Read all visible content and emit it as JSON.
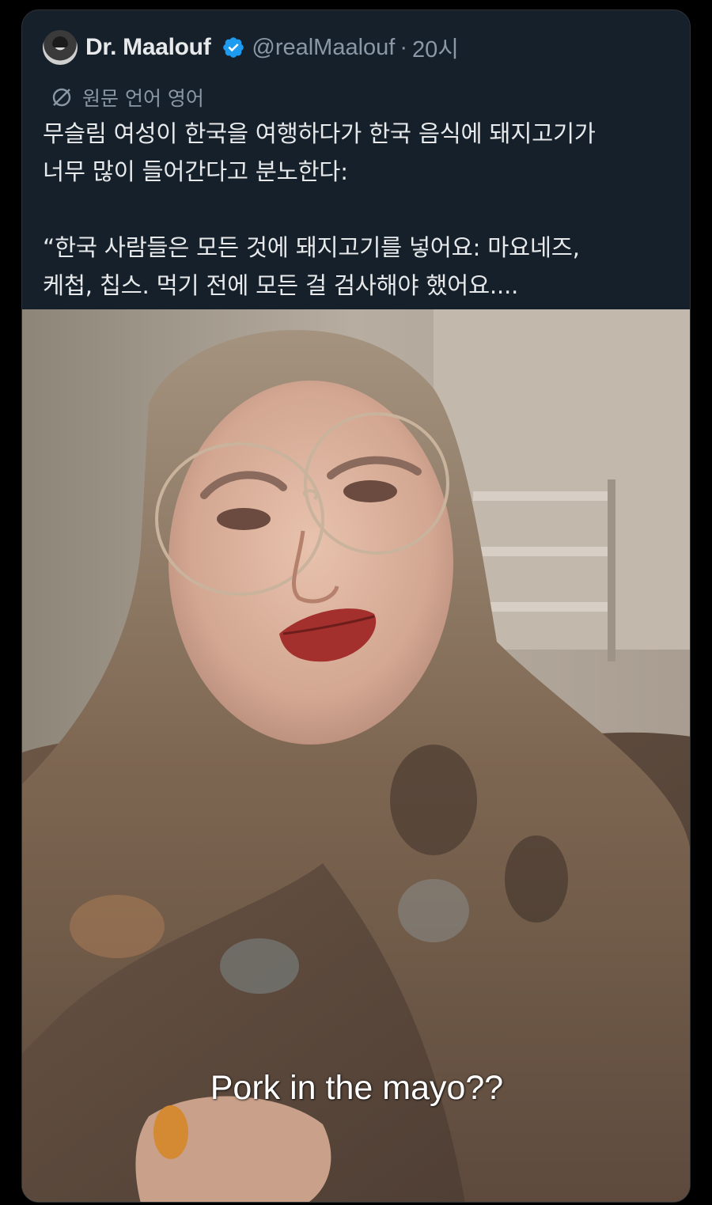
{
  "tweet": {
    "author": {
      "display_name": "Dr. Maalouf",
      "verified": true,
      "handle": "@realMaalouf",
      "separator": "·",
      "time": "20시"
    },
    "translation_label": "원문 언어 영어",
    "text_lines": [
      "무슬림 여성이 한국을 여행하다가 한국 음식에 돼지고기가",
      "너무 많이 들어간다고 분노한다:",
      "“한국 사람들은 모든 것에 돼지고기를 넣어요: 마요네즈,",
      "케첩, 칩스. 먹기 전에 모든 걸 검사해야 했어요...."
    ],
    "media": {
      "subtitle": "Pork in the mayo??"
    }
  },
  "colors": {
    "background": "#000000",
    "card": "#15202b",
    "text": "#e7e9ea",
    "muted": "#8b98a5",
    "verified_badge": "#1d9bf0"
  },
  "icons": {
    "verified": "verified-badge-icon",
    "translate": "translate-globe-icon"
  }
}
